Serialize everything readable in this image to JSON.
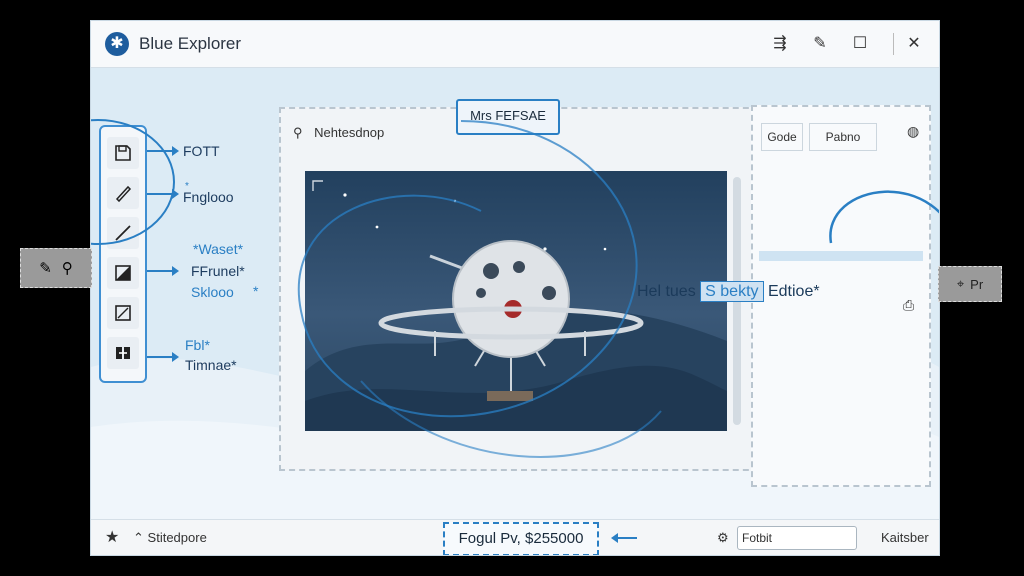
{
  "window": {
    "title": "Blue Explorer"
  },
  "titlebar": {
    "icons": [
      "align-icon",
      "pencil-icon",
      "maximize-icon",
      "close-icon"
    ]
  },
  "toolbox": {
    "tools": [
      {
        "icon": "save-icon"
      },
      {
        "icon": "brush-icon"
      },
      {
        "icon": "line-icon"
      },
      {
        "icon": "transform-icon"
      },
      {
        "icon": "rectangle-icon"
      },
      {
        "icon": "split-icon"
      }
    ],
    "labels": [
      "FOTT",
      "Fnglooo",
      "*Waset*",
      "FFrunel*",
      "Sklooo",
      "Fbl*",
      "Timnae*"
    ],
    "label_marks": [
      "*",
      "*"
    ]
  },
  "canvas": {
    "search_text": "Nehtesdnop",
    "floating_label": "Mrs FEFSAE"
  },
  "right_panel": {
    "tabs": [
      "Gode",
      "Pabno"
    ],
    "annotation_prefix": "Hel tues",
    "annotation_highlight": "S bekty",
    "annotation_suffix": "Edtioe*",
    "right_chip_text": "Pr"
  },
  "statusbar": {
    "left_text": "Stitedpore",
    "price_text": "Fogul Pv, $255000",
    "input_value": "Fotbit",
    "right_text": "Kaitsber"
  },
  "colors": {
    "accent": "#2a7fc4",
    "window_bg": "#dcebf5",
    "titlebar_bg": "#f7f9fb"
  }
}
